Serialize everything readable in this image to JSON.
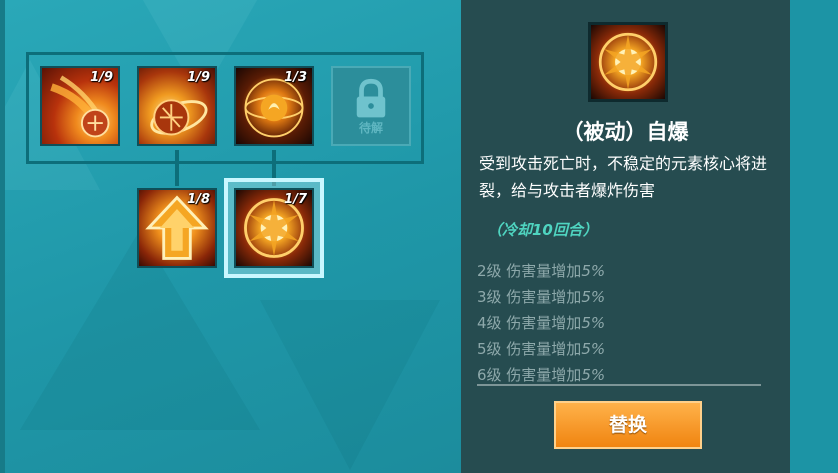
{
  "skill_tree": {
    "row1": [
      {
        "name": "fireball",
        "level": "1/9"
      },
      {
        "name": "meteor",
        "level": "1/9"
      },
      {
        "name": "fire-orb",
        "level": "1/3"
      },
      {
        "name": "locked-slot",
        "label": "待解"
      }
    ],
    "row2": [
      {
        "name": "upgrade-arrow",
        "level": "1/8"
      },
      {
        "name": "self-destruct",
        "level": "1/7"
      }
    ]
  },
  "detail": {
    "title": "（被动）自爆",
    "description": "受到攻击死亡时，不稳定的元素核心将进裂，给与攻击者爆炸伤害",
    "cooldown": "（冷却10回合）",
    "levels": [
      {
        "label": "2级 伤害量增加",
        "value": "5%"
      },
      {
        "label": "3级 伤害量增加",
        "value": "5%"
      },
      {
        "label": "4级 伤害量增加",
        "value": "5%"
      },
      {
        "label": "5级 伤害量增加",
        "value": "5%"
      },
      {
        "label": "6级 伤害量增加",
        "value": "5%"
      }
    ],
    "button_label": "替换"
  },
  "colors": {
    "background": "#1f97a8",
    "panel": "#264c50",
    "accent_orange": "#f08410",
    "cooldown_teal": "#4fd4c0"
  },
  "icons": [
    "lock-icon",
    "fireball-icon",
    "meteor-icon",
    "fire-orb-icon",
    "upgrade-arrow-icon",
    "explosion-icon"
  ]
}
